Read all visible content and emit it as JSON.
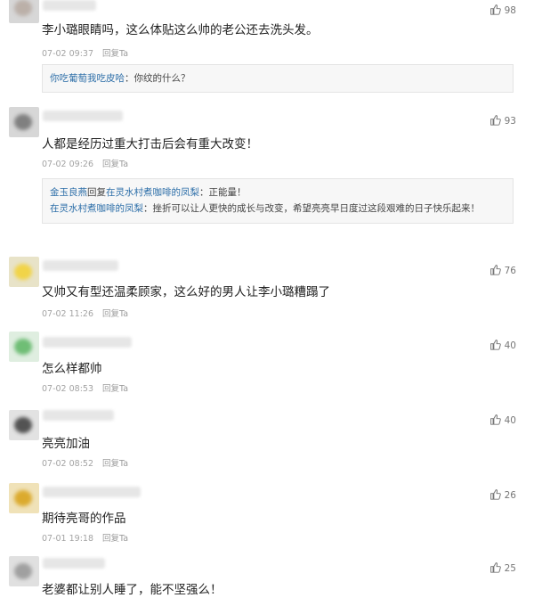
{
  "comments": [
    {
      "text": "李小璐眼睛吗，这么体贴这么帅的老公还去洗头发。",
      "time": "07-02 09:37",
      "reply_label": "回复Ta",
      "likes": "98",
      "avatar_color": "#c9bfb8",
      "quote": {
        "user": "你吃葡萄我吃皮哈",
        "text": "：你纹的什么？"
      }
    },
    {
      "text": "人都是经历过重大打击后会有重大改变！",
      "time": "07-02 09:26",
      "reply_label": "回复Ta",
      "likes": "93",
      "avatar_color": "#8a8a8a",
      "quote_lines": [
        {
          "user": "金玉良燕",
          "mid": "回复",
          "target": "在灵水村煮咖啡的凤梨",
          "text": "：正能量！"
        },
        {
          "user": "在灵水村煮咖啡的凤梨",
          "text": "：挫折可以让人更快的成长与改变，希望亮亮早日度过这段艰难的日子快乐起来！"
        }
      ]
    },
    {
      "text": "又帅又有型还温柔顾家，这么好的男人让李小璐糟蹋了",
      "time": "07-02 11:26",
      "reply_label": "回复Ta",
      "likes": "76",
      "avatar_color": "#f2d23a"
    },
    {
      "text": "怎么样都帅",
      "time": "07-02 08:53",
      "reply_label": "回复Ta",
      "likes": "40",
      "avatar_color": "#63b86a"
    },
    {
      "text": "亮亮加油",
      "time": "07-02 08:52",
      "reply_label": "回复Ta",
      "likes": "40",
      "avatar_color": "#555555"
    },
    {
      "text": "期待亮哥的作品",
      "time": "07-01 19:18",
      "reply_label": "回复Ta",
      "likes": "26",
      "avatar_color": "#d9a520"
    },
    {
      "text": "老婆都让别人睡了，能不坚强么！",
      "time": "",
      "reply_label": "",
      "likes": "25",
      "avatar_color": "#a8a8a8"
    }
  ]
}
